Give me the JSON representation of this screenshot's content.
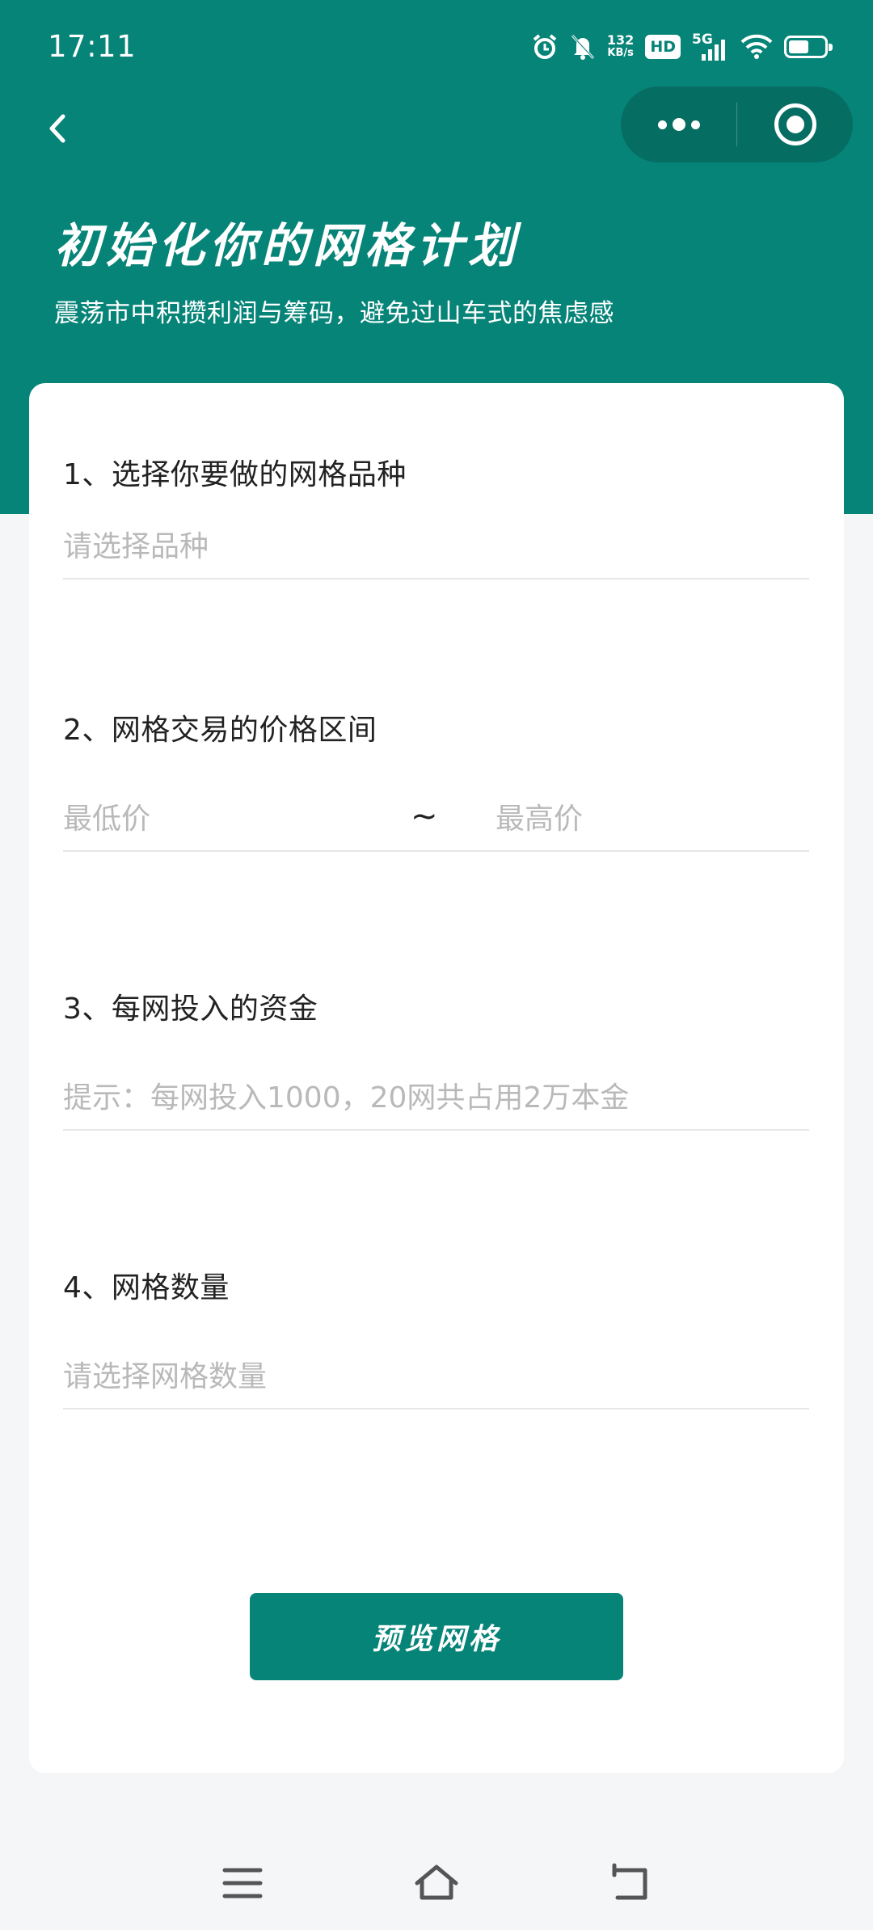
{
  "status_bar": {
    "time": "17:11",
    "net_speed_value": "132",
    "net_speed_unit": "KB/s",
    "hd_label": "HD",
    "network_label": "5G",
    "icons": [
      "alarm-icon",
      "mute-icon",
      "signal-icon",
      "wifi-icon",
      "battery-icon"
    ]
  },
  "header": {
    "title": "初始化你的网格计划",
    "subtitle": "震荡市中积攒利润与筹码，避免过山车式的焦虑感",
    "colors": {
      "brand": "#078478",
      "capsule": "#066d63"
    }
  },
  "form": {
    "variety": {
      "label": "1、选择你要做的网格品种",
      "placeholder": "请选择品种"
    },
    "price_range": {
      "label": "2、网格交易的价格区间",
      "low_placeholder": "最低价",
      "separator": "~",
      "high_placeholder": "最高价"
    },
    "capital": {
      "label": "3、每网投入的资金",
      "placeholder": "提示：每网投入1000，20网共占用2万本金"
    },
    "grid_count": {
      "label": "4、网格数量",
      "placeholder": "请选择网格数量"
    },
    "submit_label": "预览网格"
  },
  "system_nav": {
    "icons": [
      "menu-icon",
      "home-icon",
      "back-icon"
    ]
  }
}
